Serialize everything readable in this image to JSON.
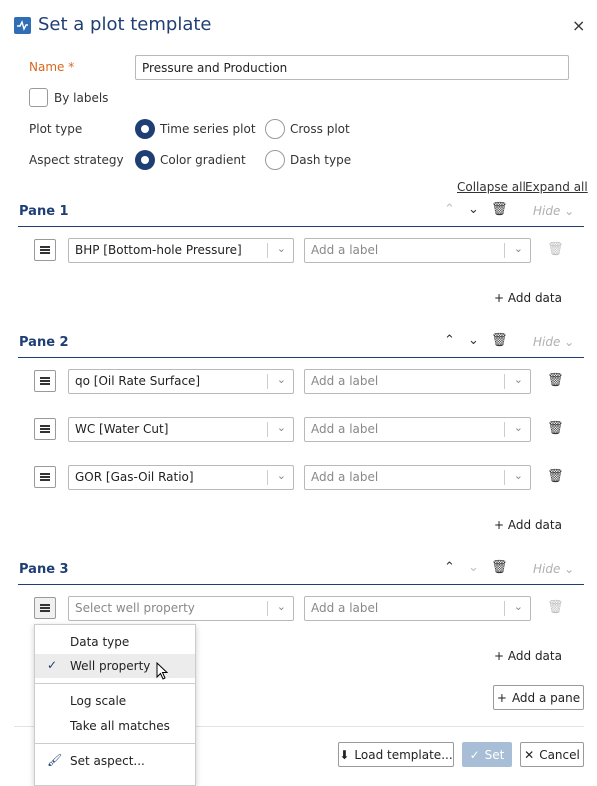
{
  "dialog": {
    "title": "Set a plot template",
    "close": "×"
  },
  "form": {
    "name_label": "Name",
    "name_required": "*",
    "name_value": "Pressure and Production",
    "by_labels": "By labels",
    "plot_type_label": "Plot type",
    "plot_type_options": [
      "Time series plot",
      "Cross plot"
    ],
    "plot_type_selected": "Time series plot",
    "aspect_label": "Aspect strategy",
    "aspect_options": [
      "Color gradient",
      "Dash type"
    ],
    "aspect_selected": "Color gradient"
  },
  "links": {
    "collapse_all": "Collapse all",
    "expand_all": "Expand all"
  },
  "panes": [
    {
      "title": "Pane 1",
      "hide": "Hide",
      "rows": [
        {
          "property": "BHP [Bottom-hole Pressure]",
          "label_placeholder": "Add a label"
        }
      ],
      "add_data": "Add data"
    },
    {
      "title": "Pane 2",
      "hide": "Hide",
      "rows": [
        {
          "property": "qo [Oil Rate Surface]",
          "label_placeholder": "Add a label"
        },
        {
          "property": "WC [Water Cut]",
          "label_placeholder": "Add a label"
        },
        {
          "property": "GOR [Gas-Oil Ratio]",
          "label_placeholder": "Add a label"
        }
      ],
      "add_data": "Add data"
    },
    {
      "title": "Pane 3",
      "hide": "Hide",
      "rows": [
        {
          "property_placeholder": "Select well property",
          "label_placeholder": "Add a label"
        }
      ],
      "add_data": "Add data"
    }
  ],
  "add_pane": "Add a pane",
  "context_menu": {
    "items": [
      "Data type",
      "Well property",
      "Log scale",
      "Take all matches",
      "Set aspect..."
    ],
    "checked": "Well property"
  },
  "footer": {
    "load_template": "Load template...",
    "set": "Set",
    "cancel": "Cancel"
  },
  "icons": [
    "plot-icon",
    "close-icon",
    "chevron-up-icon",
    "chevron-down-icon",
    "trash-icon",
    "drag-handle-icon",
    "plus-icon",
    "check-icon",
    "brush-icon",
    "download-icon",
    "cursor-icon"
  ]
}
